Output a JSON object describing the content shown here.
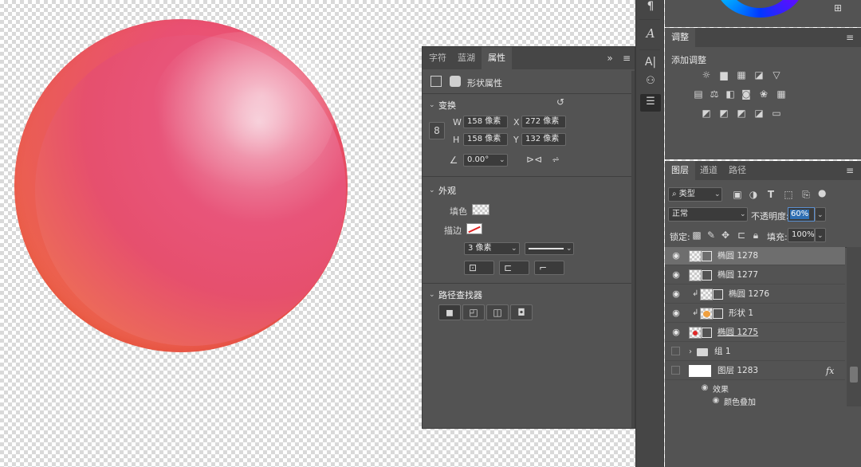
{
  "properties_panel": {
    "tabs": [
      "字符",
      "蓝湖",
      "属性"
    ],
    "active_tab": "属性",
    "shape_title": "形状属性",
    "transform": {
      "title": "变换",
      "w_label": "W",
      "w_value": "158 像素",
      "x_label": "X",
      "x_value": "272 像素",
      "h_label": "H",
      "h_value": "158 像素",
      "y_label": "Y",
      "y_value": "132 像素",
      "angle_value": "0.00°"
    },
    "appearance": {
      "title": "外观",
      "fill_label": "填色",
      "stroke_label": "描边",
      "stroke_width": "3 像素"
    },
    "pathfinder": {
      "title": "路径查找器"
    }
  },
  "adjustments_panel": {
    "tab": "调整",
    "add_label": "添加调整"
  },
  "layers_panel": {
    "tabs": [
      "图层",
      "通道",
      "路径"
    ],
    "filter_type": "类型",
    "blend_mode": "正常",
    "opacity_label": "不透明度:",
    "opacity_value": "60%",
    "lock_label": "锁定:",
    "fill_label": "填充:",
    "fill_value": "100%",
    "layers": [
      {
        "name": "椭圆 1278",
        "visible": true,
        "selected": true
      },
      {
        "name": "椭圆 1277",
        "visible": true
      },
      {
        "name": "椭圆 1276",
        "visible": true,
        "clipped": true
      },
      {
        "name": "形状 1",
        "visible": true,
        "clipped": true
      },
      {
        "name": "椭圆 1275",
        "visible": true
      },
      {
        "name": "组 1",
        "visible": false,
        "group": true
      },
      {
        "name": "图层 1283",
        "visible": false,
        "fx": "fx"
      }
    ],
    "effects_label": "效果",
    "effect_item": "颜色叠加"
  },
  "colors": {
    "panel_bg": "#535353",
    "orb_pink": "#e8557a",
    "orb_orange": "#ee6a3a",
    "selection_blue": "#2f6fb3"
  }
}
